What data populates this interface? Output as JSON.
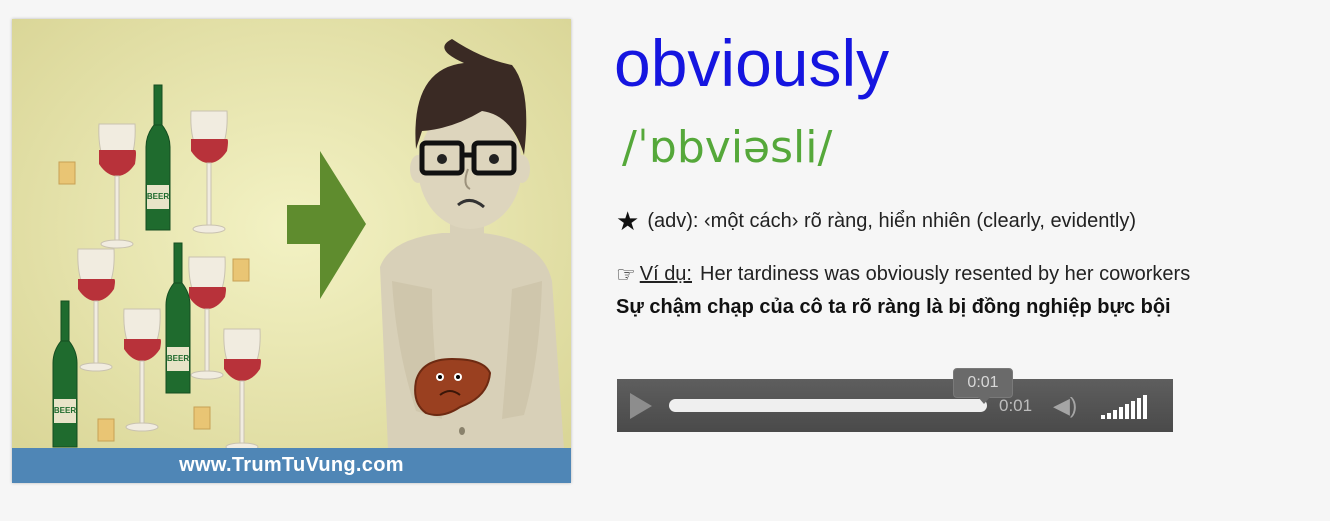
{
  "card": {
    "website": "www.TrumTuVung.com",
    "bottle_label": "BEER"
  },
  "entry": {
    "word": "obviously",
    "ipa": "/ˈɒbviəsli/",
    "definition": "(adv): ‹một cách› rõ ràng, hiển nhiên (clearly, evidently)",
    "example_label": "Ví dụ:",
    "example": "Her tardiness was obviously resented by her coworkers",
    "translation": "Sự chậm chạp của cô ta rõ ràng là bị đồng nghiệp bực bội"
  },
  "player": {
    "tooltip_time": "0:01",
    "current_time": "0:01",
    "progress": 1.0,
    "volume_level": 1.0
  },
  "colors": {
    "word": "#1515e0",
    "ipa": "#55a83a",
    "url_bar": "#4f86b6"
  }
}
